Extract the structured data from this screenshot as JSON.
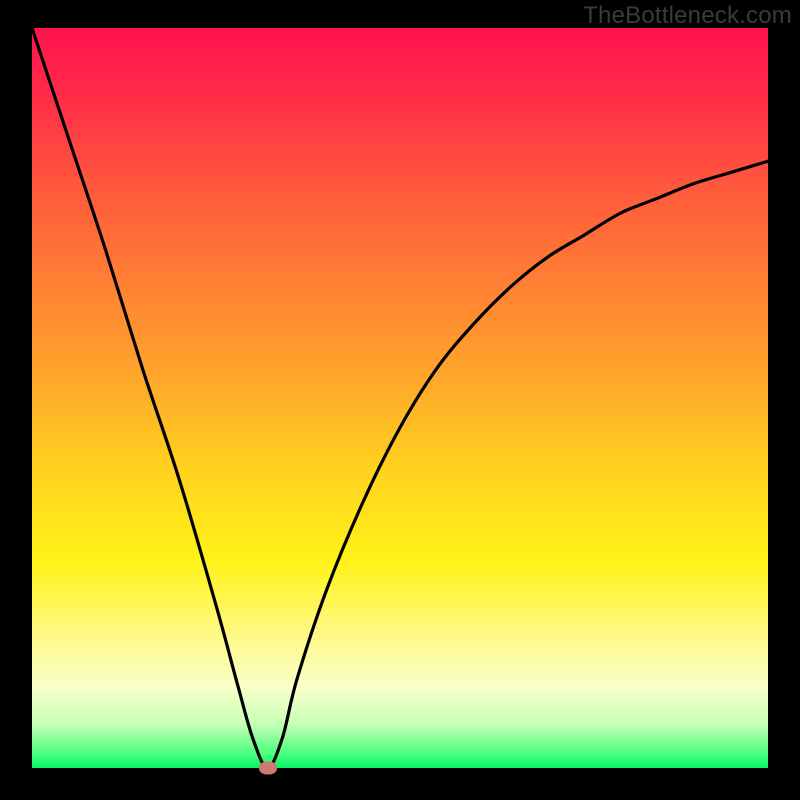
{
  "watermark": "TheBottleneck.com",
  "chart_data": {
    "type": "line",
    "title": "",
    "xlabel": "",
    "ylabel": "",
    "xlim": [
      0,
      100
    ],
    "ylim": [
      0,
      100
    ],
    "grid": false,
    "series": [
      {
        "name": "bottleneck-curve",
        "x": [
          0,
          5,
          10,
          15,
          20,
          25,
          28,
          30,
          32,
          34,
          36,
          40,
          45,
          50,
          55,
          60,
          65,
          70,
          75,
          80,
          85,
          90,
          95,
          100
        ],
        "values": [
          100,
          85,
          70,
          54,
          39,
          22,
          11,
          4,
          0,
          4,
          12,
          24,
          36,
          46,
          54,
          60,
          65,
          69,
          72,
          75,
          77,
          79,
          80.5,
          82
        ]
      }
    ],
    "marker": {
      "x": 32,
      "y": 0,
      "color": "#cc7b72"
    },
    "gradient_stops": [
      {
        "pos": 0,
        "color": "#ff1250"
      },
      {
        "pos": 60,
        "color": "#ffd31e"
      },
      {
        "pos": 89,
        "color": "#f9ffc9"
      },
      {
        "pos": 100,
        "color": "#07f567"
      }
    ]
  }
}
